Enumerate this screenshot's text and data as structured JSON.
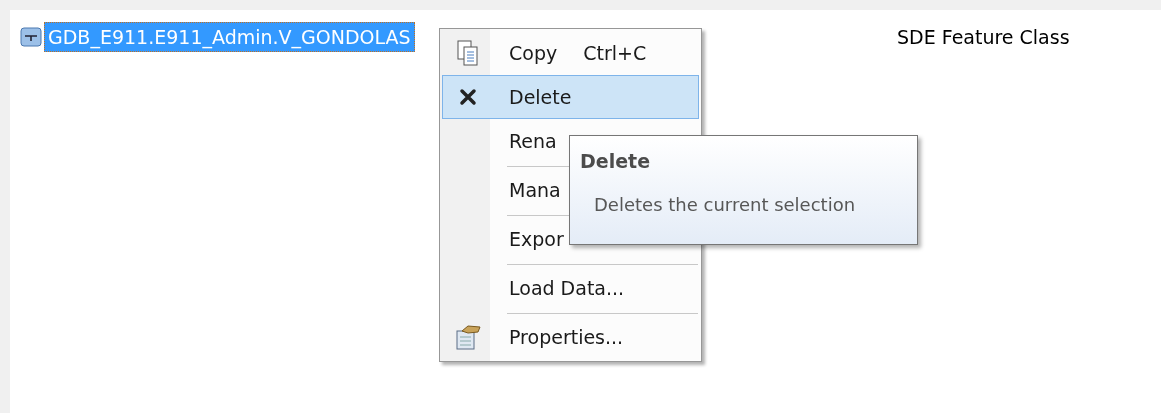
{
  "tree_item": {
    "label": "GDB_E911.E911_Admin.V_GONDOLAS",
    "selected": true,
    "type_label": "SDE Feature Class"
  },
  "context_menu": {
    "items": [
      {
        "kind": "copy",
        "label": "Copy",
        "shortcut": "Ctrl+C",
        "selected": false,
        "separator_above": false
      },
      {
        "kind": "delete",
        "label": "Delete",
        "selected": true,
        "separator_above": false
      },
      {
        "kind": "plain",
        "label": "Rena",
        "selected": false,
        "separator_above": false
      },
      {
        "kind": "plain",
        "label": "Mana",
        "selected": false,
        "separator_above": true
      },
      {
        "kind": "plain",
        "label": "Expor",
        "selected": false,
        "separator_above": true
      },
      {
        "kind": "plain",
        "label": "Load Data...",
        "selected": false,
        "separator_above": true
      },
      {
        "kind": "properties",
        "label": "Properties...",
        "selected": false,
        "separator_above": true
      }
    ]
  },
  "tooltip": {
    "title": "Delete",
    "description": "Deletes the current selection"
  }
}
